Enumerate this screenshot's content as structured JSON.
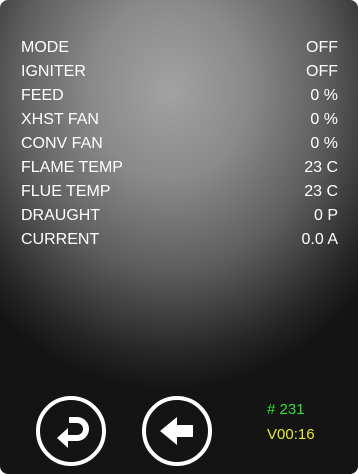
{
  "params": [
    {
      "label": "MODE",
      "value": "OFF"
    },
    {
      "label": "IGNITER",
      "value": "OFF"
    },
    {
      "label": "FEED",
      "value": "0 %"
    },
    {
      "label": "XHST FAN",
      "value": "0 %"
    },
    {
      "label": "CONV FAN",
      "value": "0 %"
    },
    {
      "label": "FLAME TEMP",
      "value": "23 C"
    },
    {
      "label": "FLUE TEMP",
      "value": "23 C"
    },
    {
      "label": "DRAUGHT",
      "value": "0 P"
    },
    {
      "label": "CURRENT",
      "value": "0.0 A"
    }
  ],
  "status": {
    "counter": "# 231",
    "timer": "V00:16",
    "counter_color": "#3bdc3b",
    "timer_color": "#e8e830"
  },
  "buttons": {
    "return_icon": "return-arrow-icon",
    "back_icon": "arrow-left-icon"
  },
  "colors": {
    "text": "#ffffff",
    "panel_light": "#a2a2a2",
    "panel_dark": "#141414"
  }
}
